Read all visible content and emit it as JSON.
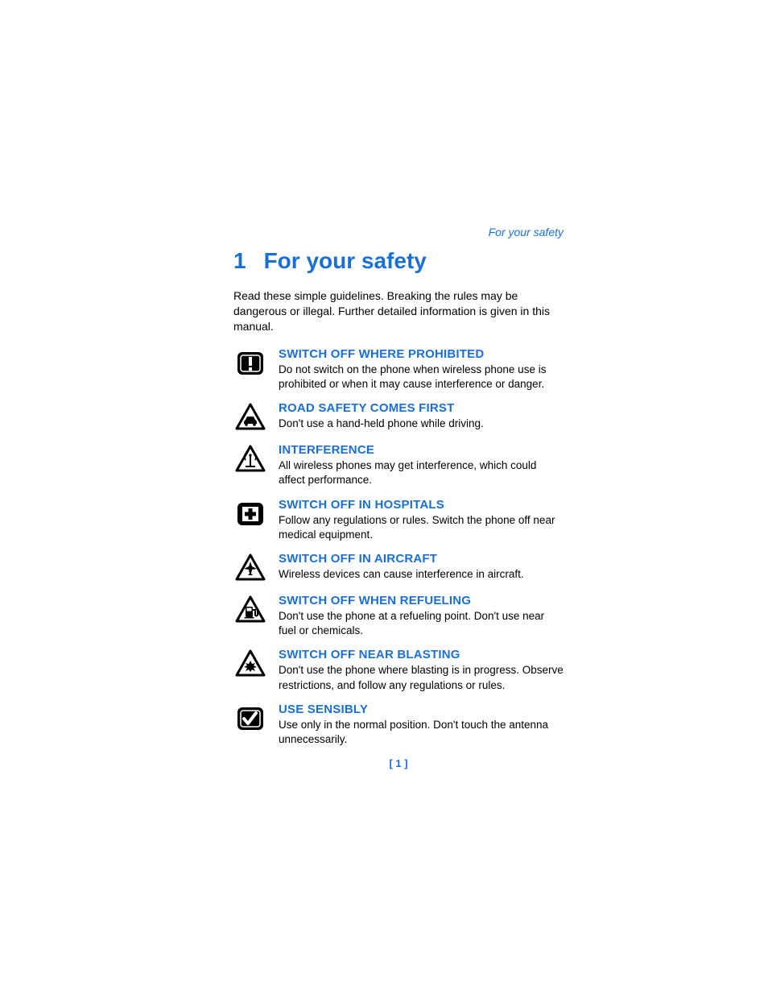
{
  "header": {
    "running": "For your safety"
  },
  "chapter": {
    "number": "1",
    "title": "For your safety"
  },
  "intro": "Read these simple guidelines. Breaking the rules may be dangerous or illegal. Further detailed information is given in this manual.",
  "items": [
    {
      "icon": "exclamation-square-icon",
      "heading": "SWITCH OFF WHERE PROHIBITED",
      "body": "Do not switch on the phone when wireless phone use is prohibited or when it may cause interference or danger."
    },
    {
      "icon": "car-triangle-icon",
      "heading": "ROAD SAFETY COMES FIRST",
      "body": "Don't use a hand-held phone while driving."
    },
    {
      "icon": "antenna-triangle-icon",
      "heading": "INTERFERENCE",
      "body": "All wireless phones may get interference, which could affect performance."
    },
    {
      "icon": "hospital-square-icon",
      "heading": "SWITCH OFF IN HOSPITALS",
      "body": "Follow any regulations or rules. Switch the phone off near medical equipment."
    },
    {
      "icon": "airplane-triangle-icon",
      "heading": "SWITCH OFF IN AIRCRAFT",
      "body": "Wireless devices can cause interference in aircraft."
    },
    {
      "icon": "fuel-triangle-icon",
      "heading": "SWITCH OFF WHEN REFUELING",
      "body": "Don't use the phone at a refueling point. Don't use near fuel or chemicals."
    },
    {
      "icon": "blast-triangle-icon",
      "heading": "SWITCH OFF NEAR BLASTING",
      "body": "Don't use the phone where blasting is in progress. Observe restrictions, and follow any regulations or rules."
    },
    {
      "icon": "check-square-icon",
      "heading": "USE SENSIBLY",
      "body": "Use only in the normal position. Don't touch the antenna unnecessarily."
    }
  ],
  "page_number": "[ 1 ]"
}
